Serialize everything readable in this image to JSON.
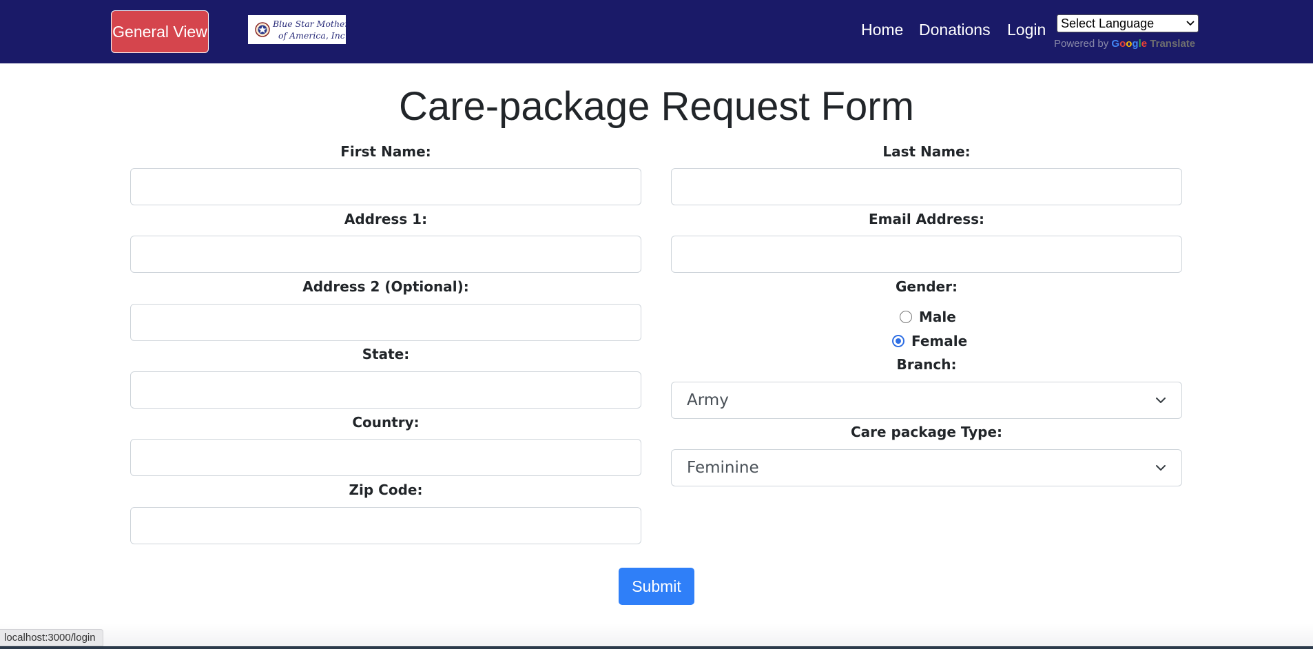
{
  "navbar": {
    "general_view_label": "General View",
    "logo": {
      "line1": "Blue Star Mothers",
      "line2": "of America, Inc."
    },
    "links": [
      {
        "label": "Home"
      },
      {
        "label": "Donations"
      },
      {
        "label": "Login"
      }
    ],
    "language_select": {
      "selected": "Select Language"
    },
    "powered_by": {
      "prefix": "Powered by",
      "brand": "Google",
      "suffix": "Translate"
    },
    "colors": {
      "background": "#1a1a68",
      "general_view_button": "#d5454d"
    }
  },
  "form": {
    "title": "Care-package Request Form",
    "left": {
      "first_name_label": "First Name:",
      "first_name_value": "",
      "address1_label": "Address 1:",
      "address1_value": "",
      "address2_label": "Address 2 (Optional):",
      "address2_value": "",
      "state_label": "State:",
      "state_value": "",
      "country_label": "Country:",
      "country_value": "",
      "zip_label": "Zip Code:",
      "zip_value": ""
    },
    "right": {
      "last_name_label": "Last Name:",
      "last_name_value": "",
      "email_label": "Email Address:",
      "email_value": "",
      "gender_label": "Gender:",
      "gender_options": [
        {
          "label": "Male",
          "checked": false
        },
        {
          "label": "Female",
          "checked": true
        }
      ],
      "branch_label": "Branch:",
      "branch_selected": "Army",
      "package_type_label": "Care package Type:",
      "package_type_selected": "Feminine"
    },
    "submit_label": "Submit",
    "accent_color": "#2f7ff8"
  },
  "status_bar": {
    "url": "localhost:3000/login"
  }
}
